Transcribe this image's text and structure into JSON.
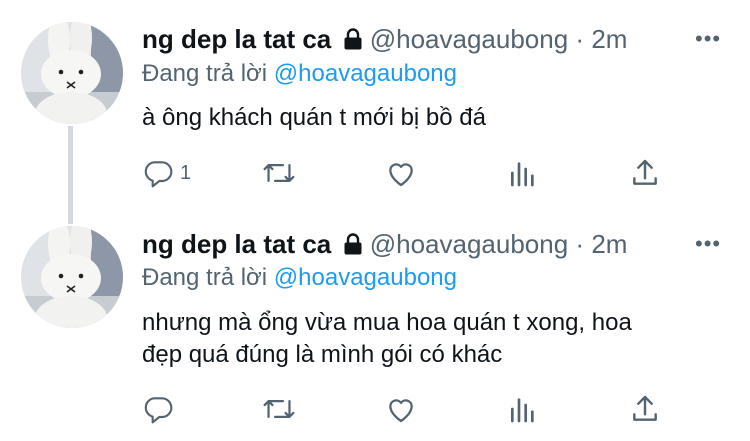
{
  "tweets": [
    {
      "display_name": "ng dep la tat ca",
      "handle": "@hoavagaubong",
      "separator": "·",
      "time": "2m",
      "more": "•••",
      "replying_prefix": "Đang trả lời",
      "replying_to": "@hoavagaubong",
      "text_lines": [
        "à ông khách quán t mới bị bồ đá"
      ],
      "reply_count": "1",
      "icons": [
        "reply-icon",
        "retweet-icon",
        "like-icon",
        "views-icon",
        "share-icon"
      ]
    },
    {
      "display_name": "ng dep la tat ca",
      "handle": "@hoavagaubong",
      "separator": "·",
      "time": "2m",
      "more": "•••",
      "replying_prefix": "Đang trả lời",
      "replying_to": "@hoavagaubong",
      "text_lines": [
        "nhưng mà ổng vừa mua hoa quán t xong, hoa",
        "đẹp quá đúng là mình gói có khác"
      ],
      "reply_count": "",
      "icons": [
        "reply-icon",
        "retweet-icon",
        "like-icon",
        "views-icon",
        "share-icon"
      ]
    }
  ],
  "colors": {
    "text": "#0f1419",
    "secondary": "#536471",
    "link": "#1d9bf0",
    "thread_line": "#d4d9dd"
  }
}
